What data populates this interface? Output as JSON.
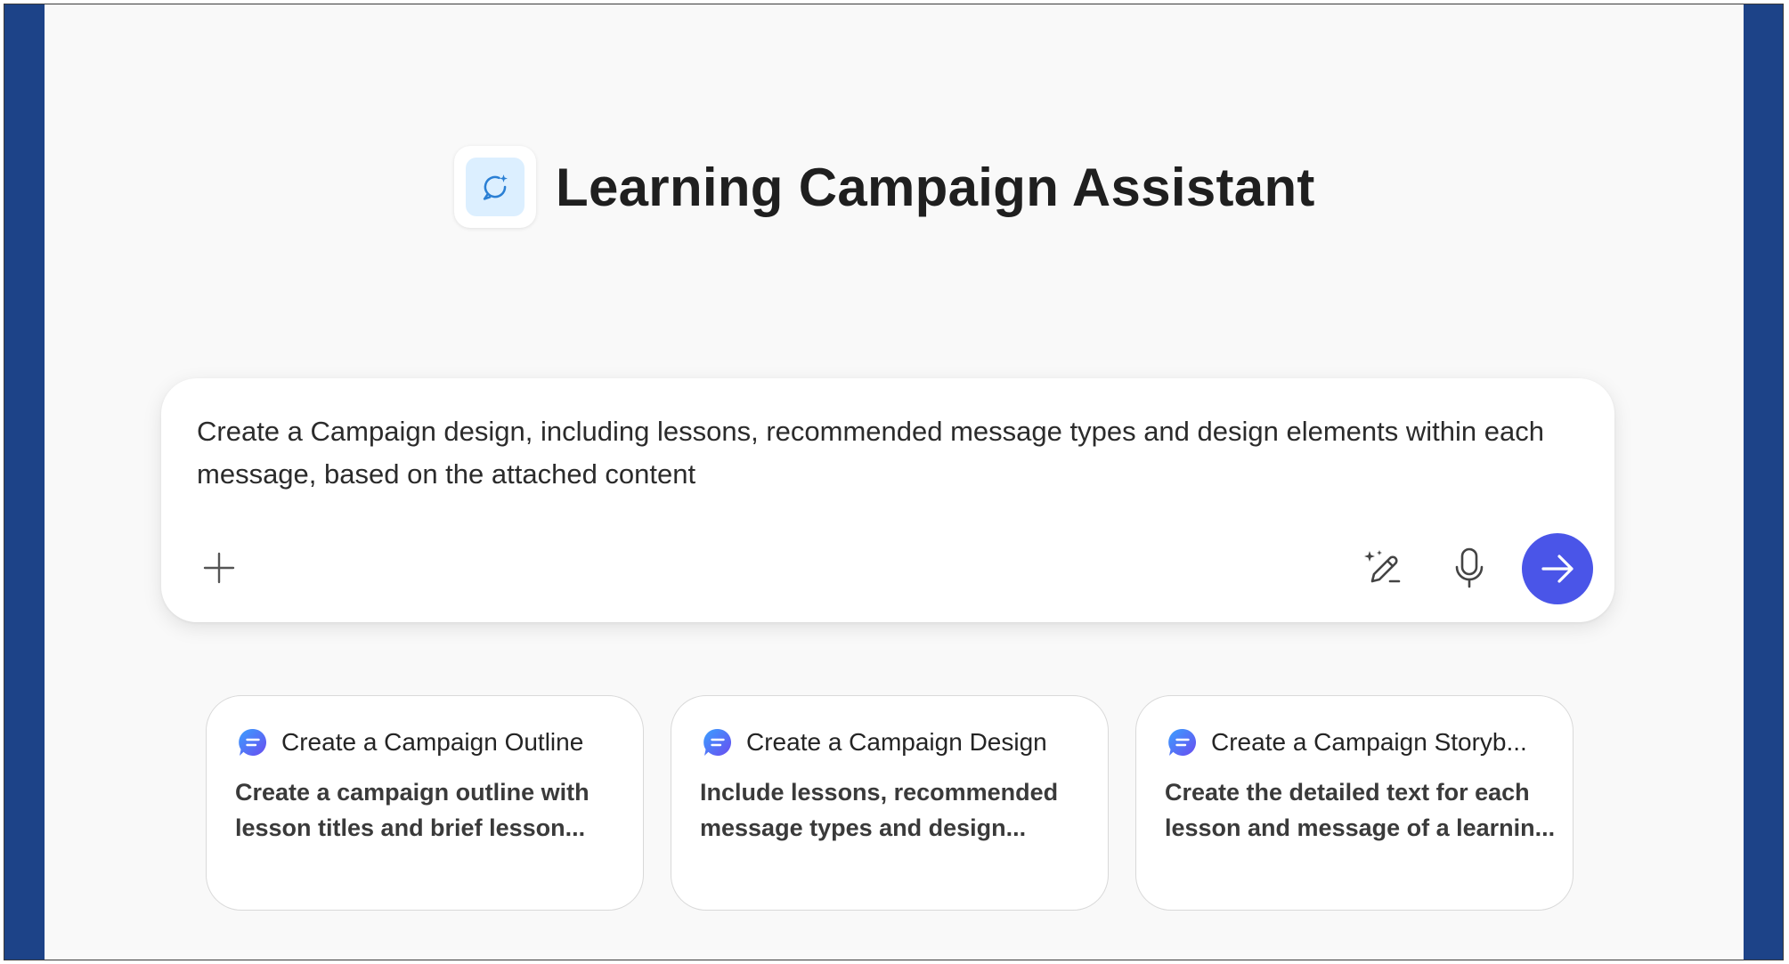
{
  "app": {
    "title": "Learning Campaign Assistant",
    "logo_icon": "assistant-sparkle-icon"
  },
  "prompt": {
    "text": "Create a Campaign design, including lessons, recommended message types and design elements within each message, based on the attached content",
    "add_icon": "plus-icon",
    "enhance_icon": "magic-pen-icon",
    "mic_icon": "microphone-icon",
    "send_icon": "arrow-right-icon"
  },
  "suggestions": [
    {
      "title": "Create a Campaign Outline",
      "description": "Create a campaign outline with lesson titles and brief lesson..."
    },
    {
      "title": "Create a Campaign Design",
      "description": "Include lessons, recommended message types and design..."
    },
    {
      "title": "Create a Campaign Storyb...",
      "description": "Create the detailed text for each lesson and message of a learnin..."
    }
  ],
  "colors": {
    "side_bars": "#1d4388",
    "background": "#f9f9f9",
    "send_button": "#4a55e8",
    "logo_tile": "#dcefff"
  }
}
